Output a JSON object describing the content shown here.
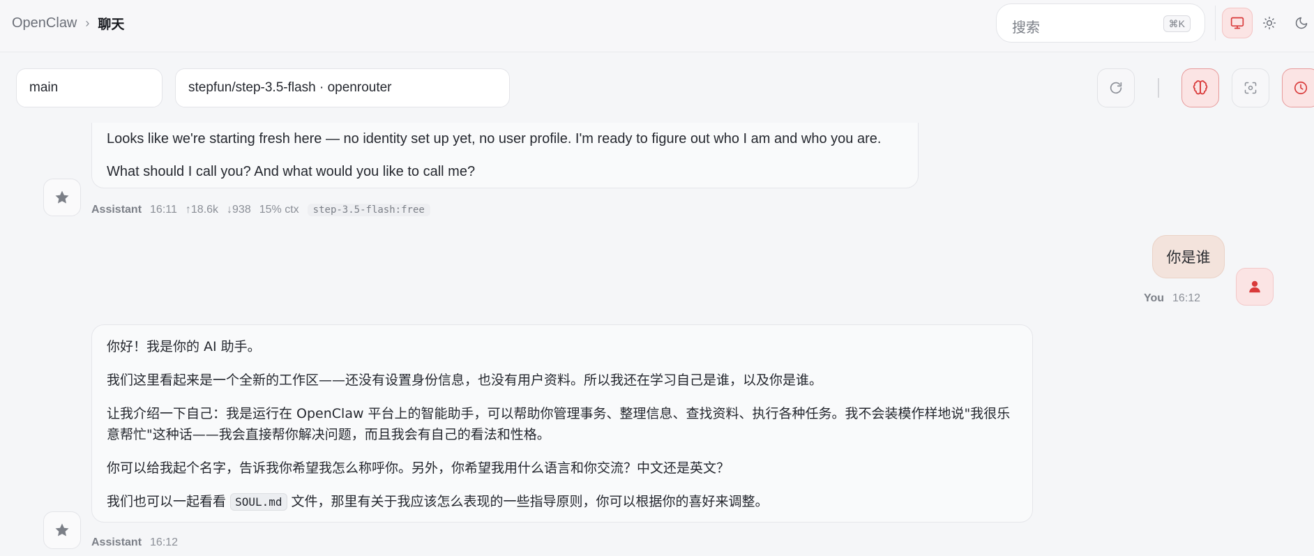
{
  "header": {
    "breadcrumb_root": "OpenClaw",
    "breadcrumb_sep": "›",
    "breadcrumb_current": "聊天",
    "search_placeholder": "搜索",
    "search_shortcut": "⌘K",
    "theme_options": [
      "monitor-icon",
      "sun-icon",
      "moon-icon"
    ]
  },
  "session": {
    "agent_value": "main",
    "model_value": "stepfun/step-3.5-flash · openrouter",
    "tools": [
      "refresh-icon",
      "brain-icon",
      "focus-icon",
      "clock-icon"
    ]
  },
  "messages": [
    {
      "role": "Assistant",
      "time": "16:11",
      "tokens_in": "↑18.6k",
      "tokens_out": "↓938",
      "context": "15% ctx",
      "model_tag": "step-3.5-flash:free",
      "paragraphs": [
        "Looks like we're starting fresh here — no identity set up yet, no user profile. I'm ready to figure out who I am and who you are.",
        "What should I call you? And what would you like to call me?"
      ]
    },
    {
      "role": "You",
      "time": "16:12",
      "text": "你是谁"
    },
    {
      "role": "Assistant",
      "time": "16:12",
      "paragraphs": [
        "你好！我是你的 AI 助手。",
        "我们这里看起来是一个全新的工作区——还没有设置身份信息，也没有用户资料。所以我还在学习自己是谁，以及你是谁。",
        "让我介绍一下自己：我是运行在 OpenClaw 平台上的智能助手，可以帮助你管理事务、整理信息、查找资料、执行各种任务。我不会装模作样地说\"我很乐意帮忙\"这种话——我会直接帮你解决问题，而且我会有自己的看法和性格。",
        "你可以给我起个名字，告诉我你希望我怎么称呼你。另外，你希望我用什么语言和你交流？中文还是英文？"
      ],
      "last_para_prefix": "我们也可以一起看看",
      "last_para_code": "SOUL.md",
      "last_para_suffix": "文件，那里有关于我应该怎么表现的一些指导原则，你可以根据你的喜好来调整。"
    }
  ],
  "colors": {
    "accent": "#d93a3a",
    "accent_bg": "#fbe4e4",
    "background": "#f5f6f8"
  }
}
